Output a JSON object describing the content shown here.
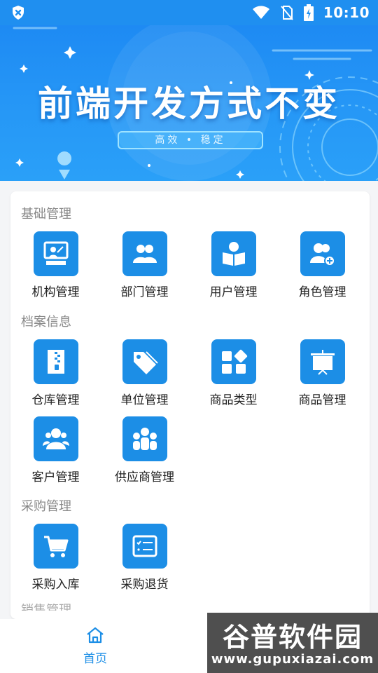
{
  "status_bar": {
    "time": "10:10"
  },
  "banner": {
    "headline": "前端开发方式不变",
    "tagline": "高效 • 稳定"
  },
  "sections": [
    {
      "title": "基础管理",
      "items": [
        {
          "label": "机构管理",
          "icon": "presenter-board-icon"
        },
        {
          "label": "部门管理",
          "icon": "team-people-icon"
        },
        {
          "label": "用户管理",
          "icon": "user-book-icon"
        },
        {
          "label": "角色管理",
          "icon": "user-add-icon"
        }
      ]
    },
    {
      "title": "档案信息",
      "items": [
        {
          "label": "仓库管理",
          "icon": "zip-archive-icon"
        },
        {
          "label": "单位管理",
          "icon": "tags-icon"
        },
        {
          "label": "商品类型",
          "icon": "category-grid-icon"
        },
        {
          "label": "商品管理",
          "icon": "display-board-icon"
        },
        {
          "label": "客户管理",
          "icon": "customers-icon"
        },
        {
          "label": "供应商管理",
          "icon": "suppliers-group-icon"
        }
      ]
    },
    {
      "title": "采购管理",
      "items": [
        {
          "label": "采购入库",
          "icon": "cart-icon"
        },
        {
          "label": "采购退货",
          "icon": "return-list-icon"
        }
      ]
    }
  ],
  "next_section_partial": "销售管理",
  "tabbar": {
    "home_label": "首页"
  },
  "watermark": {
    "title": "谷普软件园",
    "url": "www.gupuxiazai.com"
  },
  "colors": {
    "primary": "#1c8ee6",
    "banner_top": "#1b86f2",
    "watermark_bg": "#4f4f4f"
  }
}
